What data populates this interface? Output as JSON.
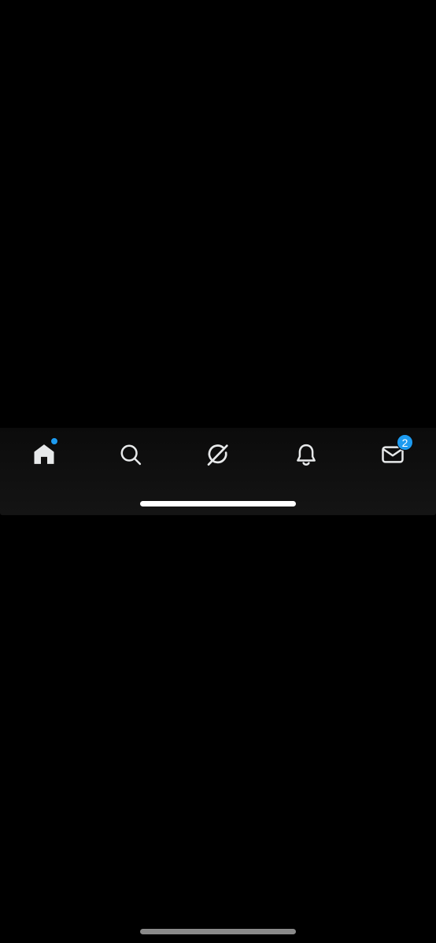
{
  "colors": {
    "background": "#000000",
    "icon": "#e7e9ea",
    "accent": "#1d9bf0",
    "indicator_inner": "#ffffff",
    "indicator_bottom": "#8a8a8a"
  },
  "tab_bar": {
    "tabs": [
      {
        "id": "home",
        "icon": "home-icon",
        "active": true,
        "has_dot": true
      },
      {
        "id": "search",
        "icon": "search-icon",
        "active": false
      },
      {
        "id": "grok",
        "icon": "grok-icon",
        "active": false
      },
      {
        "id": "notifications",
        "icon": "bell-icon",
        "active": false
      },
      {
        "id": "messages",
        "icon": "mail-icon",
        "active": false,
        "badge": "2"
      }
    ]
  }
}
